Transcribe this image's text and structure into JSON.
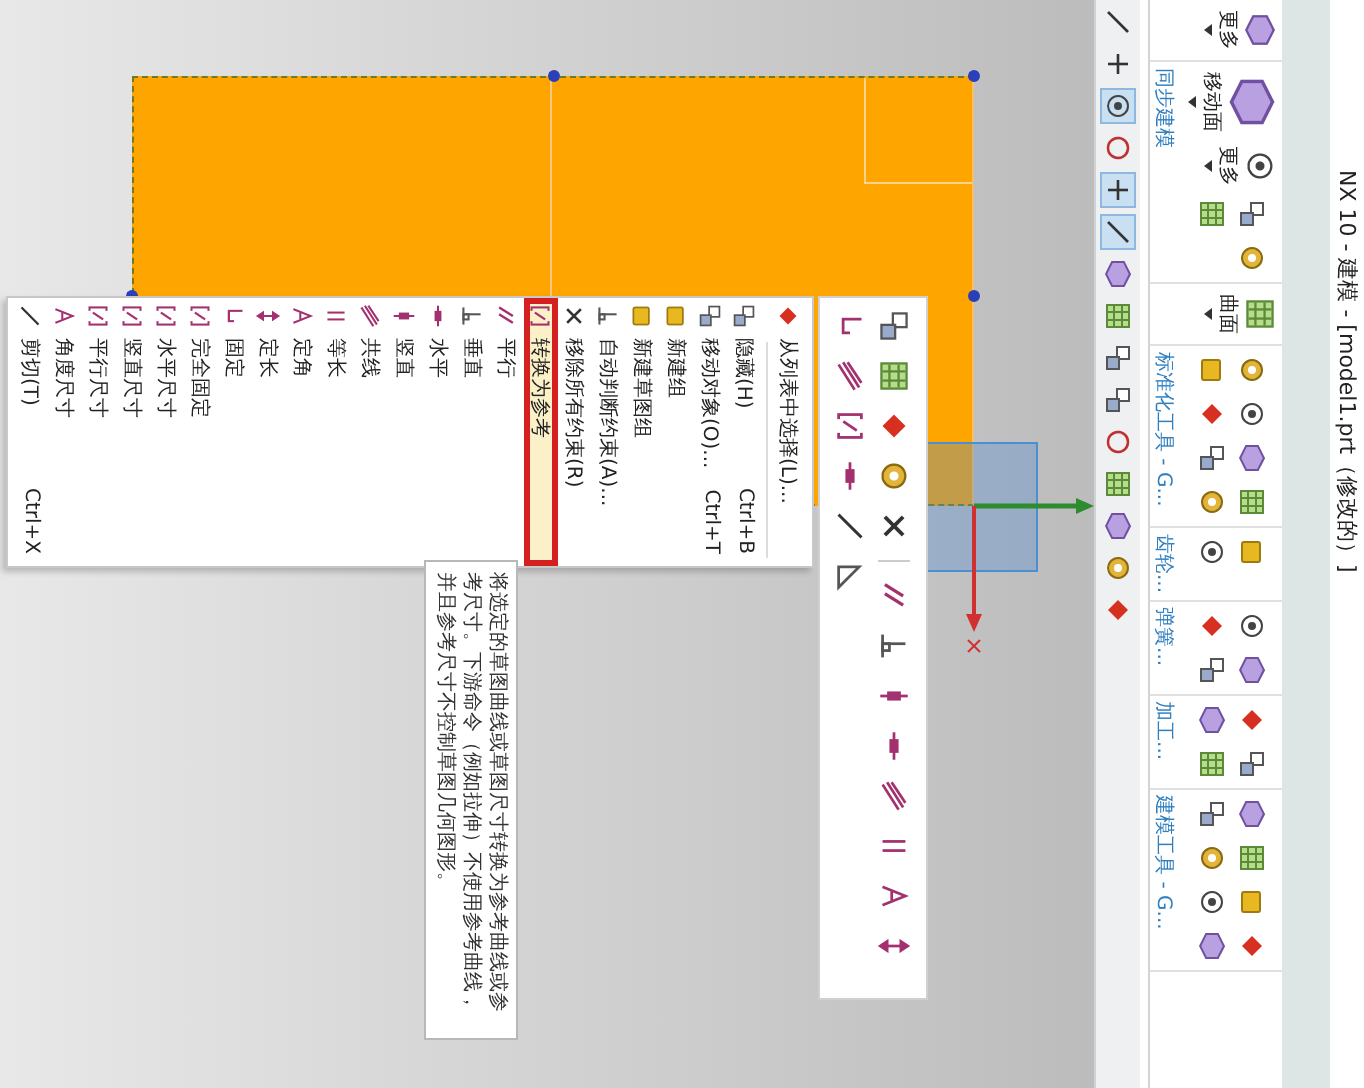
{
  "window": {
    "title": "NX 10 - 建模 - [model1.prt（修改的）]"
  },
  "ribbon": {
    "groups": [
      {
        "buttons": [
          {
            "kind": "more",
            "label": "更多"
          }
        ]
      },
      {
        "label": "同步建模",
        "buttons": [
          {
            "kind": "large",
            "label": "移动面"
          },
          {
            "kind": "icon"
          },
          {
            "kind": "icon"
          },
          {
            "kind": "icon"
          },
          {
            "kind": "more",
            "label": "更多"
          }
        ]
      },
      {
        "buttons": [
          {
            "kind": "more",
            "label": "曲面"
          }
        ]
      },
      {
        "label": "标准化工具 - G...",
        "buttons": [
          {
            "kind": "icon"
          },
          {
            "kind": "icon"
          },
          {
            "kind": "icon"
          },
          {
            "kind": "icon"
          },
          {
            "kind": "icon"
          },
          {
            "kind": "icon"
          },
          {
            "kind": "icon"
          },
          {
            "kind": "icon"
          }
        ]
      },
      {
        "label": "齿轮...",
        "buttons": [
          {
            "kind": "icon"
          },
          {
            "kind": "icon"
          }
        ]
      },
      {
        "label": "弹簧...",
        "buttons": [
          {
            "kind": "icon"
          },
          {
            "kind": "icon"
          },
          {
            "kind": "icon"
          },
          {
            "kind": "icon"
          }
        ]
      },
      {
        "label": "加工...",
        "buttons": [
          {
            "kind": "icon"
          },
          {
            "kind": "icon"
          },
          {
            "kind": "icon"
          },
          {
            "kind": "icon"
          }
        ]
      },
      {
        "label": "建模工具 - G...",
        "buttons": [
          {
            "kind": "icon"
          },
          {
            "kind": "icon"
          },
          {
            "kind": "icon"
          },
          {
            "kind": "icon"
          },
          {
            "kind": "icon"
          },
          {
            "kind": "icon"
          },
          {
            "kind": "icon"
          },
          {
            "kind": "icon"
          }
        ]
      }
    ]
  },
  "snap_toolbar": {
    "buttons": [
      {
        "on": false
      },
      {
        "on": false
      },
      {
        "on": true
      },
      {
        "on": false
      },
      {
        "on": true
      },
      {
        "on": true
      },
      {
        "on": false
      },
      {
        "on": false
      },
      {
        "on": false
      },
      {
        "on": false
      },
      {
        "on": false
      },
      {
        "on": false
      },
      {
        "on": false
      },
      {
        "on": false
      },
      {
        "on": false
      }
    ]
  },
  "context_menu": {
    "sections": [
      {
        "items": [
          {
            "label": "从列表中选择(L)...",
            "selected": false
          }
        ]
      },
      {
        "items": [
          {
            "label": "隐藏(H)",
            "shortcut": "Ctrl+B",
            "selected": false
          },
          {
            "label": "移动对象(O)...",
            "shortcut": "Ctrl+T",
            "selected": false
          },
          {
            "label": "新建组",
            "selected": false
          },
          {
            "label": "新建草图组",
            "selected": false
          },
          {
            "label": "自动判断约束(A)...",
            "selected": false
          },
          {
            "label": "移除所有约束(R)",
            "selected": false
          },
          {
            "label": "转换为参考",
            "selected": true
          },
          {
            "label": "平行",
            "selected": false
          },
          {
            "label": "垂直",
            "selected": false
          },
          {
            "label": "水平",
            "selected": false
          },
          {
            "label": "竖直",
            "selected": false
          },
          {
            "label": "共线",
            "selected": false
          },
          {
            "label": "等长",
            "selected": false
          },
          {
            "label": "定角",
            "selected": false
          },
          {
            "label": "定长",
            "selected": false
          },
          {
            "label": "固定",
            "selected": false
          },
          {
            "label": "完全固定",
            "selected": false
          },
          {
            "label": "水平尺寸",
            "selected": false
          },
          {
            "label": "竖直尺寸",
            "selected": false
          },
          {
            "label": "平行尺寸",
            "selected": false
          },
          {
            "label": "角度尺寸",
            "selected": false
          },
          {
            "label": "剪切(T)",
            "shortcut": "Ctrl+X",
            "selected": false
          }
        ]
      }
    ]
  },
  "tooltip": {
    "text": "将选定的草图曲线或草图尺寸转换为参考曲线或参考尺寸。下游命令（例如拉伸）不使用参考曲线，并且参考尺寸不控制草图几何图形。"
  }
}
